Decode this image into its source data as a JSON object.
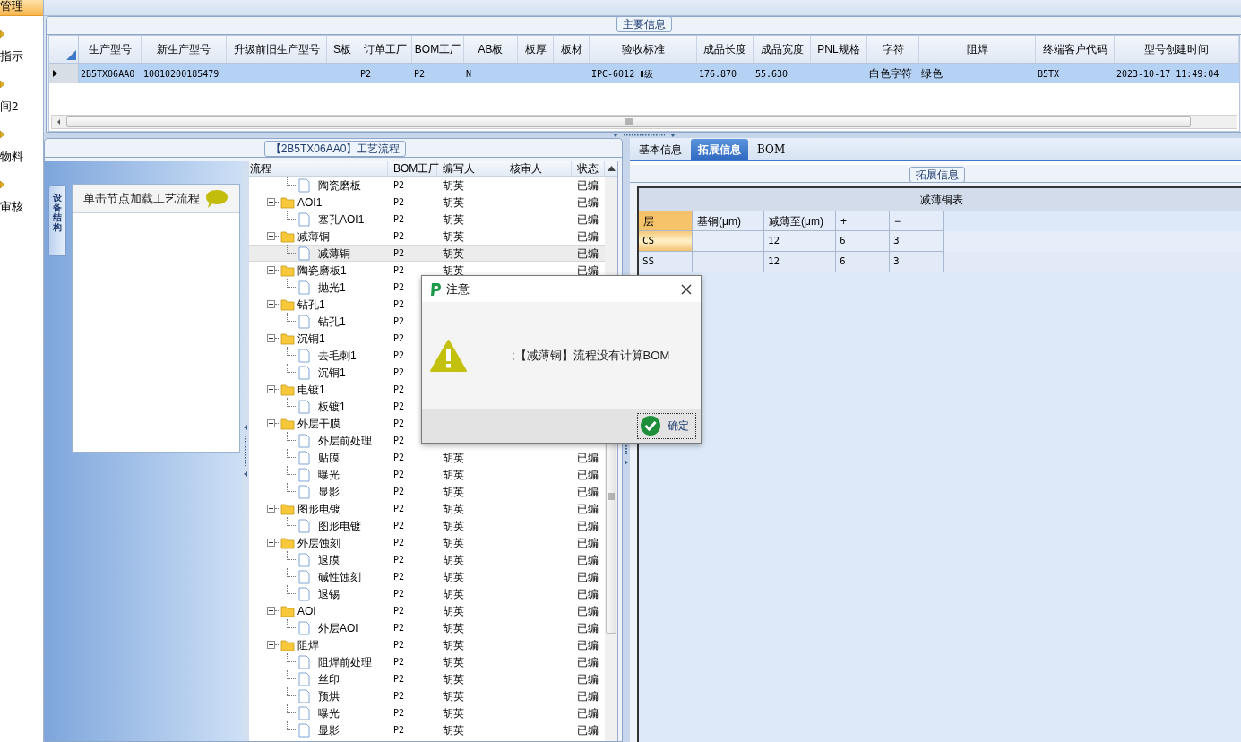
{
  "sidebar": {
    "items": [
      {
        "label": "管理",
        "selected": true
      },
      {
        "label": "指示",
        "selected": false
      },
      {
        "label": "间2",
        "selected": false
      },
      {
        "label": "物料",
        "selected": false
      },
      {
        "label": "审核",
        "selected": false
      }
    ]
  },
  "main_info": {
    "title": "主要信息",
    "columns": [
      "生产型号",
      "新生产型号",
      "升级前旧生产型号",
      "S板",
      "订单工厂",
      "BOM工厂",
      "AB板",
      "板厚",
      "板材",
      "验收标准",
      "成品长度",
      "成品宽度",
      "PNL规格",
      "字符",
      "阻焊",
      "终端客户代码",
      "型号创建时间"
    ],
    "rows": [
      {
        "selected": true,
        "cells": [
          "2B5TX06AA0",
          "10010200185479",
          null,
          null,
          "P2",
          "P2",
          "N",
          null,
          null,
          "IPC-6012 Ⅱ级",
          "176.870",
          "55.630",
          null,
          "白色字符",
          "绿色",
          "B5TX",
          "2023-10-17 11:49:04"
        ]
      }
    ]
  },
  "process_flow": {
    "title": "【2B5TX06AA0】工艺流程",
    "side_tab": "设备结构",
    "hint": "单击节点加载工艺流程",
    "columns": [
      "流程",
      "BOM工厂",
      "编写人",
      "核审人",
      "状态"
    ],
    "nodes": [
      {
        "kind": "file",
        "label": "陶瓷磨板",
        "bom": "P2",
        "writer": "胡英",
        "status": "已编",
        "selected": false
      },
      {
        "kind": "folder",
        "label": "AOI1",
        "bom": "P2",
        "writer": "胡英",
        "status": "已编",
        "selected": false,
        "expanded": true,
        "children": [
          {
            "kind": "file",
            "label": "塞孔AOI1",
            "bom": "P2",
            "writer": "胡英",
            "status": "已编",
            "selected": false
          }
        ]
      },
      {
        "kind": "folder",
        "label": "减薄铜",
        "bom": "P2",
        "writer": "胡英",
        "status": "已编",
        "selected": false,
        "expanded": true,
        "children": [
          {
            "kind": "file",
            "label": "减薄铜",
            "bom": "P2",
            "writer": "胡英",
            "status": "已编",
            "selected": true
          }
        ]
      },
      {
        "kind": "folder",
        "label": "陶瓷磨板1",
        "bom": "P2",
        "writer": "胡英",
        "status": "已编",
        "selected": false,
        "expanded": true,
        "children": [
          {
            "kind": "file",
            "label": "抛光1",
            "bom": "P2",
            "selected": false
          }
        ]
      },
      {
        "kind": "folder",
        "label": "钻孔1",
        "bom": "P2",
        "selected": false,
        "expanded": true,
        "children": [
          {
            "kind": "file",
            "label": "钻孔1",
            "bom": "P2",
            "selected": false
          }
        ]
      },
      {
        "kind": "folder",
        "label": "沉铜1",
        "bom": "P2",
        "selected": false,
        "expanded": true,
        "children": [
          {
            "kind": "file",
            "label": "去毛刺1",
            "bom": "P2",
            "selected": false
          },
          {
            "kind": "file",
            "label": "沉铜1",
            "bom": "P2",
            "selected": false
          }
        ]
      },
      {
        "kind": "folder",
        "label": "电镀1",
        "bom": "P2",
        "selected": false,
        "expanded": true,
        "children": [
          {
            "kind": "file",
            "label": "板镀1",
            "bom": "P2",
            "selected": false
          }
        ]
      },
      {
        "kind": "folder",
        "label": "外层干膜",
        "bom": "P2",
        "selected": false,
        "expanded": true,
        "children": [
          {
            "kind": "file",
            "label": "外层前处理",
            "bom": "P2",
            "selected": false
          },
          {
            "kind": "file",
            "label": "贴膜",
            "bom": "P2",
            "writer": "胡英",
            "status": "已编",
            "selected": false
          },
          {
            "kind": "file",
            "label": "曝光",
            "bom": "P2",
            "writer": "胡英",
            "status": "已编",
            "selected": false
          },
          {
            "kind": "file",
            "label": "显影",
            "bom": "P2",
            "writer": "胡英",
            "status": "已编",
            "selected": false
          }
        ]
      },
      {
        "kind": "folder",
        "label": "图形电镀",
        "bom": "P2",
        "writer": "胡英",
        "status": "已编",
        "selected": false,
        "expanded": true,
        "children": [
          {
            "kind": "file",
            "label": "图形电镀",
            "bom": "P2",
            "writer": "胡英",
            "status": "已编",
            "selected": false
          }
        ]
      },
      {
        "kind": "folder",
        "label": "外层蚀刻",
        "bom": "P2",
        "writer": "胡英",
        "status": "已编",
        "selected": false,
        "expanded": true,
        "children": [
          {
            "kind": "file",
            "label": "退膜",
            "bom": "P2",
            "writer": "胡英",
            "status": "已编",
            "selected": false
          },
          {
            "kind": "file",
            "label": "碱性蚀刻",
            "bom": "P2",
            "writer": "胡英",
            "status": "已编",
            "selected": false
          },
          {
            "kind": "file",
            "label": "退锡",
            "bom": "P2",
            "writer": "胡英",
            "status": "已编",
            "selected": false
          }
        ]
      },
      {
        "kind": "folder",
        "label": "AOI",
        "bom": "P2",
        "writer": "胡英",
        "status": "已编",
        "selected": false,
        "expanded": true,
        "children": [
          {
            "kind": "file",
            "label": "外层AOI",
            "bom": "P2",
            "writer": "胡英",
            "status": "已编",
            "selected": false
          }
        ]
      },
      {
        "kind": "folder",
        "label": "阻焊",
        "bom": "P2",
        "writer": "胡英",
        "status": "已编",
        "selected": false,
        "expanded": true,
        "children": [
          {
            "kind": "file",
            "label": "阻焊前处理",
            "bom": "P2",
            "writer": "胡英",
            "status": "已编",
            "selected": false
          },
          {
            "kind": "file",
            "label": "丝印",
            "bom": "P2",
            "writer": "胡英",
            "status": "已编",
            "selected": false
          },
          {
            "kind": "file",
            "label": "预烘",
            "bom": "P2",
            "writer": "胡英",
            "status": "已编",
            "selected": false
          },
          {
            "kind": "file",
            "label": "曝光",
            "bom": "P2",
            "writer": "胡英",
            "status": "已编",
            "selected": false
          },
          {
            "kind": "file",
            "label": "显影",
            "bom": "P2",
            "writer": "胡英",
            "status": "已编",
            "selected": false
          }
        ]
      }
    ]
  },
  "detail": {
    "tabs": [
      {
        "label": "基本信息",
        "selected": false
      },
      {
        "label": "拓展信息",
        "selected": true
      },
      {
        "label": "BOM",
        "selected": false
      }
    ],
    "group_title": "拓展信息",
    "table_title": "减薄铜表",
    "columns": [
      "层",
      "基铜(μm)",
      "减薄至(μm)",
      "+",
      "−"
    ],
    "rows": [
      {
        "selected": true,
        "cells": [
          "CS",
          null,
          "12",
          "6",
          "3"
        ]
      },
      {
        "selected": false,
        "cells": [
          "SS",
          null,
          "12",
          "6",
          "3"
        ]
      }
    ]
  },
  "dialog": {
    "title": "注意",
    "message": ";【减薄铜】流程没有计算BOM",
    "button": "确定"
  }
}
